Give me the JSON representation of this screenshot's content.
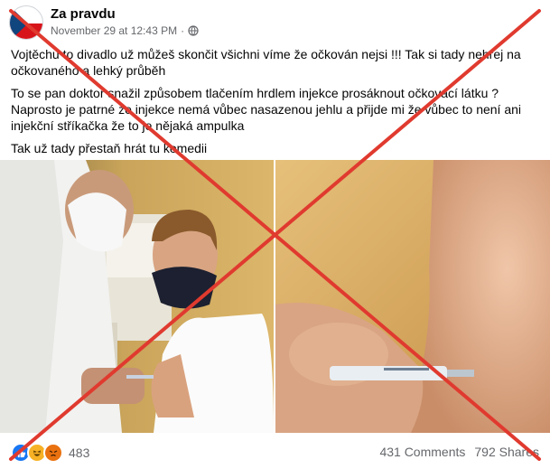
{
  "post": {
    "page_name": "Za pravdu",
    "timestamp": "November 29 at 12:43 PM",
    "separator": "·",
    "privacy_icon": "globe-icon",
    "paragraphs": [
      "Vojtěchu to divadlo už můžeš skončit všichni víme že očkován nejsi !!! Tak si tady nehrej na očkovaného a lehký průběh",
      "To se pan doktor snažil způsobem tlačením hrdlem injekce prosáknout očkovací látku ? Naprosto je patrné že injekce nemá vůbec nasazenou jehlu a přijde mi že vůbec to není ani injekční stříkačka že to je nějaká ampulka",
      "Tak už tady přestaň hrát tu komedii"
    ]
  },
  "footer": {
    "reactions": [
      "like",
      "haha",
      "angry"
    ],
    "reaction_count": "483",
    "comments": "431 Comments",
    "shares": "792 Shares"
  },
  "overlay": {
    "cross_color": "#e03a2f",
    "icon": "red-x-overlay"
  }
}
